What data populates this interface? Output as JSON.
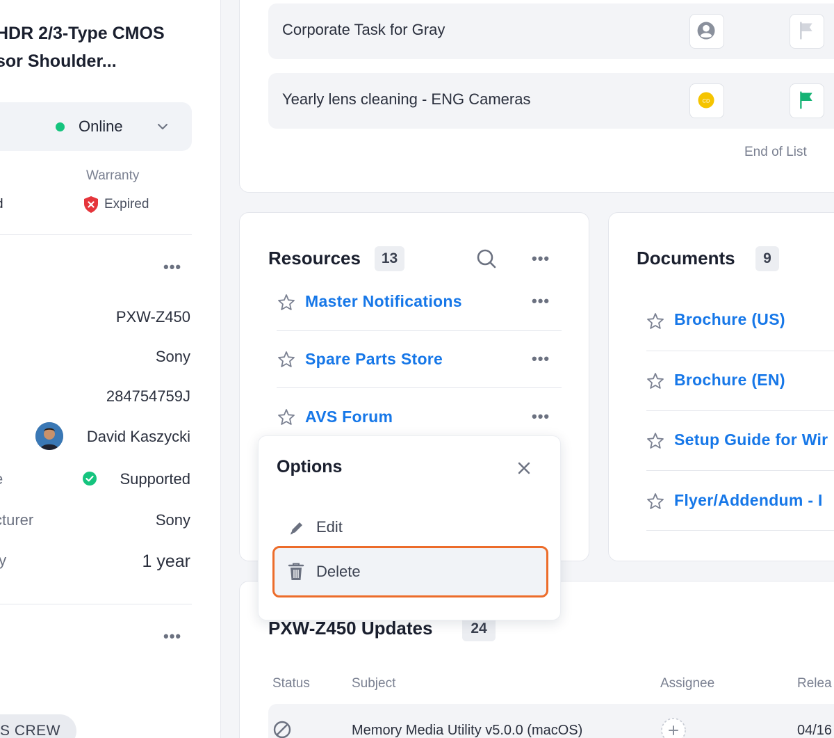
{
  "asset": {
    "title_line1": "HDR 2/3-Type CMOS",
    "title_line2": "sor Shoulder...",
    "status": "Online",
    "warranty_label": "Warranty",
    "warranty_left_clip": "d",
    "warranty_value": "Expired"
  },
  "properties": {
    "model": "PXW-Z450",
    "brand": "Sony",
    "serial": "284754759J",
    "owner": "David Kaszycki",
    "support_label_clip": "e",
    "support_value": "Supported",
    "manufacturer_label_clip": "cturer",
    "manufacturer_value": "Sony",
    "warranty_period_label_clip": "ty",
    "warranty_period_value": "1 year"
  },
  "crew_chip": "S CREW",
  "tasks": [
    {
      "title": "Corporate Task for Gray"
    },
    {
      "title": "Yearly lens cleaning - ENG Cameras",
      "avatar_initials": "CD"
    }
  ],
  "end_of_list": "End of List",
  "resources": {
    "title": "Resources",
    "count": "13",
    "items": [
      {
        "label": "Master Notifications"
      },
      {
        "label": "Spare Parts Store"
      },
      {
        "label": "AVS Forum"
      }
    ]
  },
  "documents": {
    "title": "Documents",
    "count": "9",
    "items": [
      {
        "label": "Brochure (US)"
      },
      {
        "label": "Brochure (EN)"
      },
      {
        "label": "Setup Guide for Wir"
      },
      {
        "label": "Flyer/Addendum - I"
      }
    ]
  },
  "options_menu": {
    "title": "Options",
    "edit_label": "Edit",
    "delete_label": "Delete"
  },
  "updates": {
    "title": "PXW-Z450 Updates",
    "count": "24",
    "columns": {
      "status": "Status",
      "subject": "Subject",
      "assignee": "Assignee",
      "release": "Relea"
    },
    "rows": [
      {
        "subject": "Memory Media Utility v5.0.0 (macOS)",
        "date": "04/16"
      }
    ]
  },
  "colors": {
    "accent_link": "#1677e8",
    "online": "#15c47e",
    "expired": "#e5353b",
    "highlight": "#ec6c2a",
    "flag_green": "#14b374",
    "avatar_yellow": "#f5c400"
  }
}
